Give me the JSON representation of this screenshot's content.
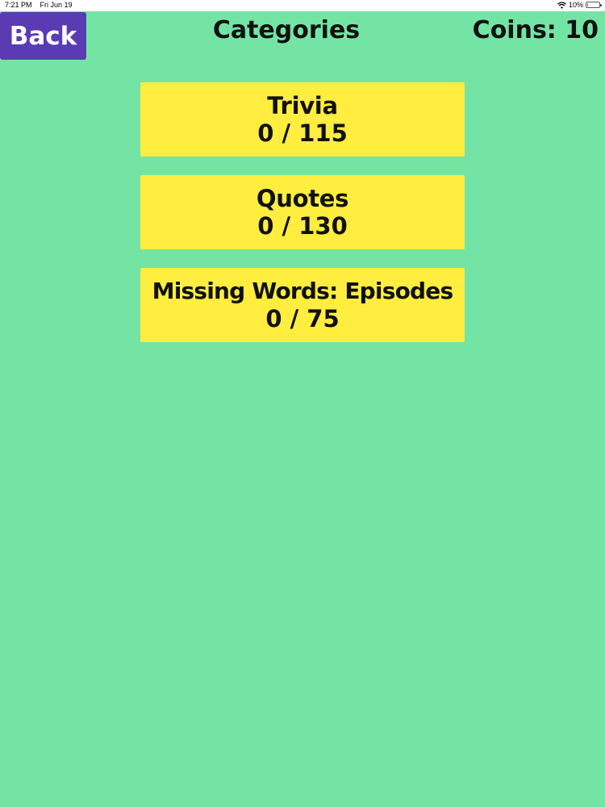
{
  "status_bar": {
    "time": "7:21 PM",
    "date": "Fri Jun 19",
    "battery_text": "10%",
    "battery_level": 0.1,
    "battery_color": "#e02b2b"
  },
  "header": {
    "back_label": "Back",
    "title": "Categories",
    "coins_label": "Coins: 10"
  },
  "categories": [
    {
      "name": "Trivia",
      "progress": "0 / 115"
    },
    {
      "name": "Quotes",
      "progress": "0 / 130"
    },
    {
      "name": "Missing Words: Episodes",
      "progress": "0 / 75"
    }
  ],
  "colors": {
    "background": "#74e4a4",
    "card": "#ffed3f",
    "back_button": "#5a3bb3"
  }
}
